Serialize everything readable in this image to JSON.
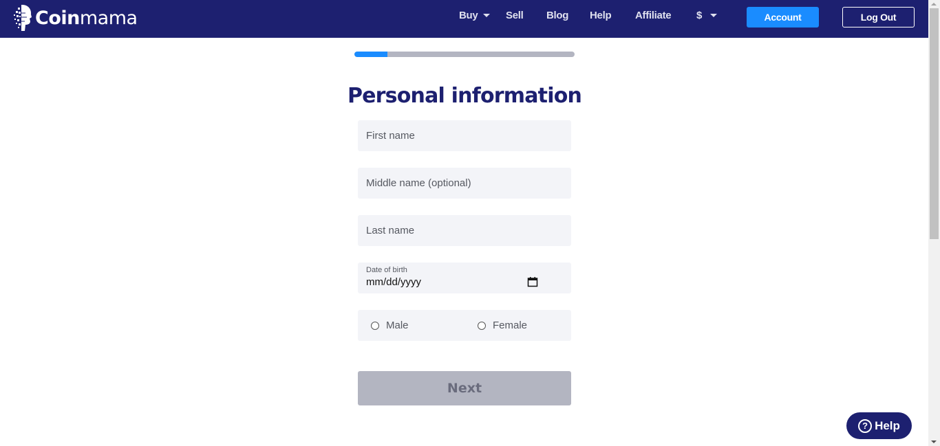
{
  "header": {
    "logo_bold": "Coin",
    "logo_light": "mama",
    "nav": [
      {
        "label": "Buy",
        "has_dropdown": true
      },
      {
        "label": "Sell",
        "has_dropdown": false
      },
      {
        "label": "Blog",
        "has_dropdown": false
      },
      {
        "label": "Help",
        "has_dropdown": false
      },
      {
        "label": "Affiliate",
        "has_dropdown": false
      },
      {
        "label": "$",
        "has_dropdown": true
      }
    ],
    "account_label": "Account",
    "logout_label": "Log Out"
  },
  "form": {
    "progress_percent": 15,
    "title": "Personal information",
    "first_name": {
      "placeholder": "First name",
      "value": ""
    },
    "middle_name": {
      "placeholder": "Middle name (optional)",
      "value": ""
    },
    "last_name": {
      "placeholder": "Last name",
      "value": ""
    },
    "dob": {
      "label": "Date of birth",
      "value": "mm/dd/yyyy",
      "icon": "calendar-icon"
    },
    "gender": {
      "options": [
        {
          "label": "Male",
          "selected": false
        },
        {
          "label": "Female",
          "selected": false
        }
      ]
    },
    "next_label": "Next"
  },
  "help_widget": {
    "label": "Help",
    "icon_glyph": "?"
  },
  "colors": {
    "navbar": "#1d2070",
    "accent": "#1a8cff",
    "field_bg": "#f3f4f8",
    "disabled_button": "#b3b5c1"
  }
}
